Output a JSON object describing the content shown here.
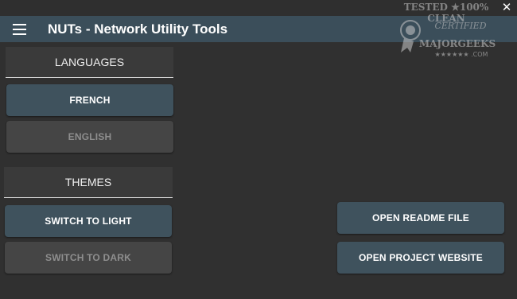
{
  "window": {
    "close_glyph": "✕"
  },
  "appbar": {
    "title": "NUTs - Network Utility Tools",
    "menu_icon": "hamburger-menu-icon",
    "bar_color": "#3b4e5a"
  },
  "languages": {
    "header": "LANGUAGES",
    "buttons": [
      {
        "label": "FRENCH",
        "state": "enabled"
      },
      {
        "label": "ENGLISH",
        "state": "disabled"
      }
    ]
  },
  "themes": {
    "header": "THEMES",
    "buttons": [
      {
        "label": "SWITCH TO LIGHT",
        "state": "enabled"
      },
      {
        "label": "SWITCH TO DARK",
        "state": "disabled"
      }
    ]
  },
  "actions": {
    "readme_label": "OPEN README FILE",
    "website_label": "OPEN PROJECT WEBSITE"
  },
  "watermark": {
    "top": "TESTED ★100% CLEAN",
    "mid": "CERTIFIED",
    "bottom": "MAJORGEEKS",
    "stars": "★★★★★★ .COM"
  },
  "colors": {
    "primary_button": "#3f525d",
    "disabled_button": "#454545",
    "background": "#303030"
  }
}
